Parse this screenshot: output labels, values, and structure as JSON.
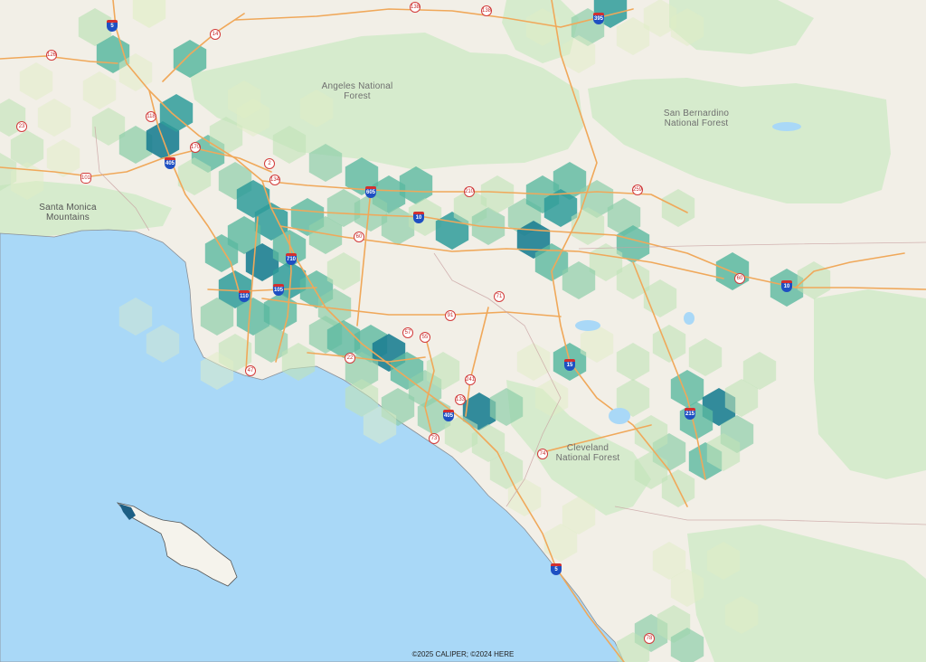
{
  "colors": {
    "ocean": "#a9d8f7",
    "land": "#f2efe7",
    "forest": "#d6ebcd",
    "road": "#f0a85a",
    "hex_scale": [
      "#f6f9d7",
      "#dfeec5",
      "#bfe2b8",
      "#8fcfaa",
      "#5bb9a0",
      "#2f9c9a",
      "#1d7f92"
    ]
  },
  "place_labels": [
    {
      "id": "angeles",
      "text": "Angeles National\nForest"
    },
    {
      "id": "sanbernardino",
      "text": "San Bernardino\nNational Forest"
    },
    {
      "id": "santamonica",
      "text": "Santa Monica\nMountains"
    },
    {
      "id": "cleveland",
      "text": "Cleveland\nNational Forest"
    }
  ],
  "highways": [
    {
      "type": "interstate",
      "num": "5"
    },
    {
      "type": "interstate",
      "num": "405"
    },
    {
      "type": "interstate",
      "num": "605"
    },
    {
      "type": "interstate",
      "num": "10"
    },
    {
      "type": "interstate",
      "num": "710"
    },
    {
      "type": "interstate",
      "num": "110"
    },
    {
      "type": "interstate",
      "num": "105"
    },
    {
      "type": "interstate",
      "num": "15"
    },
    {
      "type": "interstate",
      "num": "215"
    },
    {
      "type": "interstate",
      "num": "405"
    },
    {
      "type": "interstate",
      "num": "5"
    },
    {
      "type": "interstate",
      "num": "10"
    },
    {
      "type": "interstate",
      "num": "395"
    },
    {
      "type": "state",
      "num": "14"
    },
    {
      "type": "state",
      "num": "138"
    },
    {
      "type": "state",
      "num": "138"
    },
    {
      "type": "state",
      "num": "126"
    },
    {
      "type": "state",
      "num": "118"
    },
    {
      "type": "state",
      "num": "170"
    },
    {
      "type": "state",
      "num": "23"
    },
    {
      "type": "state",
      "num": "2"
    },
    {
      "type": "state",
      "num": "134"
    },
    {
      "type": "state",
      "num": "210"
    },
    {
      "type": "state",
      "num": "259"
    },
    {
      "type": "state",
      "num": "60"
    },
    {
      "type": "state",
      "num": "60"
    },
    {
      "type": "state",
      "num": "91"
    },
    {
      "type": "state",
      "num": "71"
    },
    {
      "type": "state",
      "num": "57"
    },
    {
      "type": "state",
      "num": "55"
    },
    {
      "type": "state",
      "num": "22"
    },
    {
      "type": "state",
      "num": "47"
    },
    {
      "type": "state",
      "num": "241"
    },
    {
      "type": "state",
      "num": "133"
    },
    {
      "type": "state",
      "num": "73"
    },
    {
      "type": "state",
      "num": "74"
    },
    {
      "type": "state",
      "num": "78"
    },
    {
      "type": "us",
      "num": "101"
    }
  ],
  "copyright": "©2025 CALIPER; ©2024 HERE"
}
